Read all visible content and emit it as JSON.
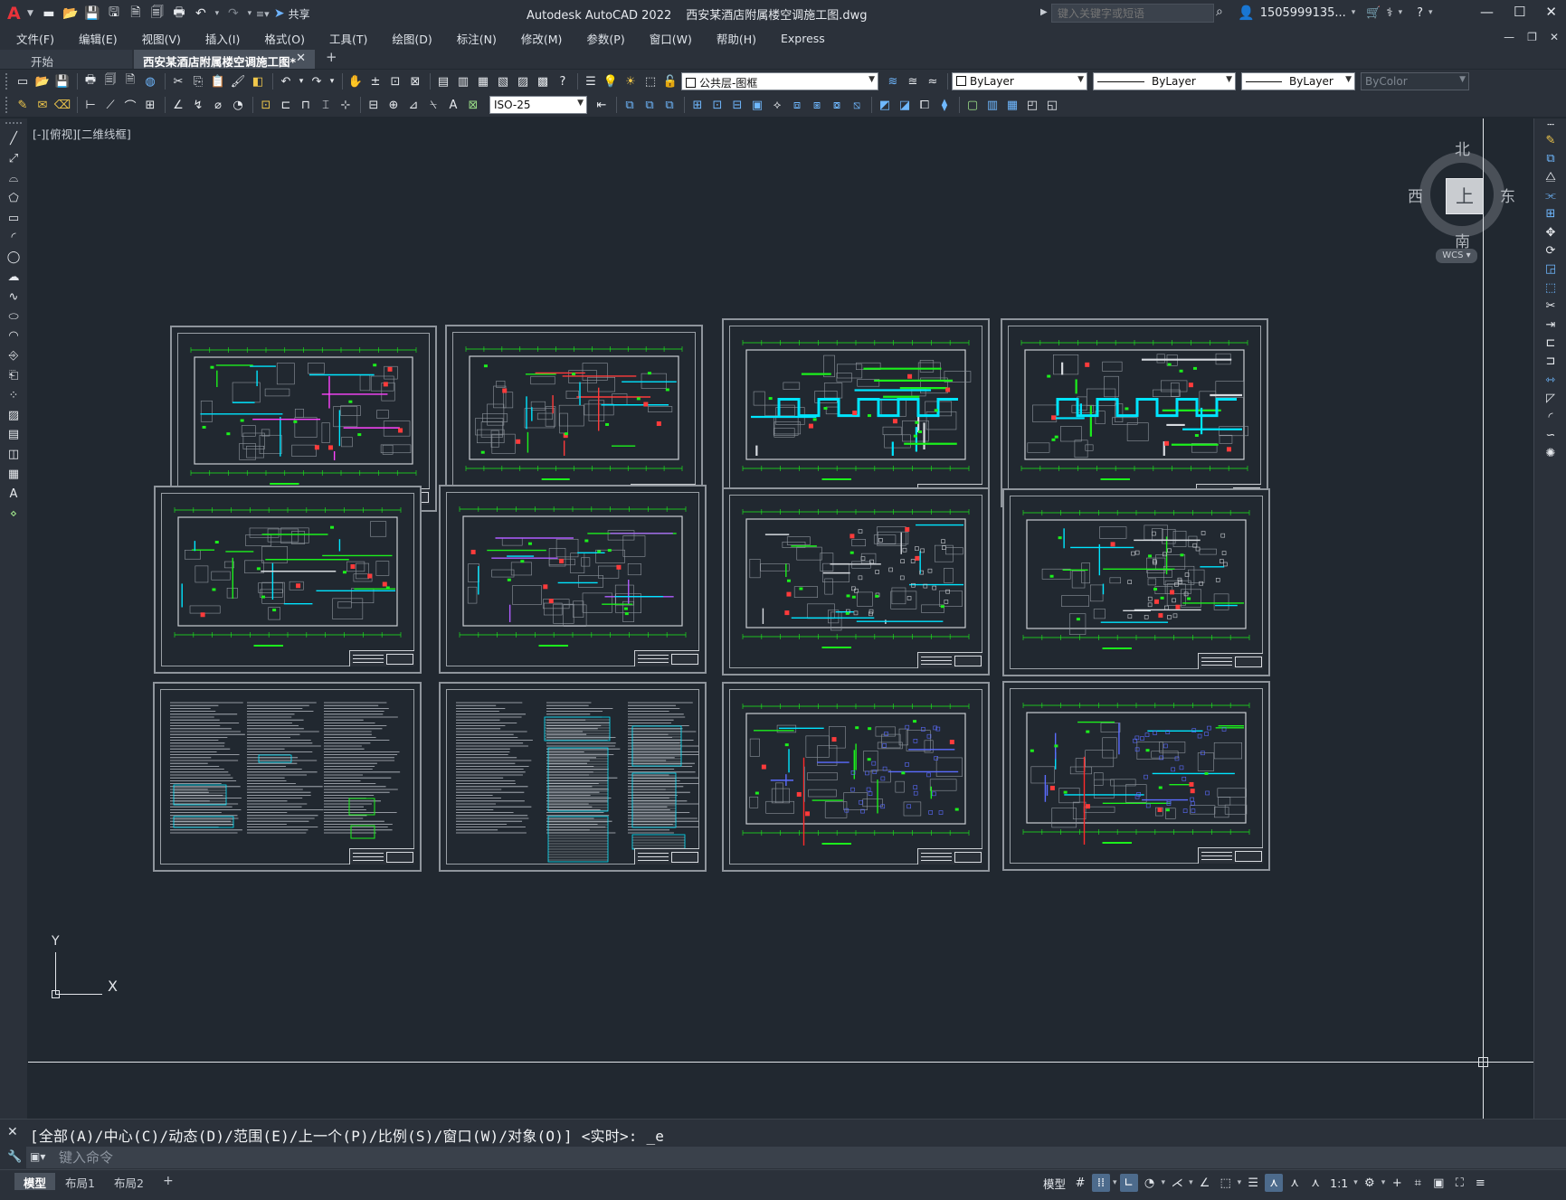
{
  "titlebar": {
    "app_title": "Autodesk AutoCAD 2022",
    "file_title": "西安某酒店附属楼空调施工图.dwg",
    "share_label": "共享",
    "search_placeholder": "键入关键字或短语",
    "user": "1505999135...",
    "icons": [
      "new-icon",
      "open-icon",
      "save-icon",
      "saveas-icon",
      "publish-icon",
      "plot-icon",
      "undo-icon",
      "redo-icon"
    ]
  },
  "menu": [
    "文件(F)",
    "编辑(E)",
    "视图(V)",
    "插入(I)",
    "格式(O)",
    "工具(T)",
    "绘图(D)",
    "标注(N)",
    "修改(M)",
    "参数(P)",
    "窗口(W)",
    "帮助(H)",
    "Express"
  ],
  "tabs": {
    "start": "开始",
    "document": "西安某酒店附属楼空调施工图*",
    "add": "+"
  },
  "toolbar": {
    "layer_name": "公共层-图框",
    "color": "ByLayer",
    "linetype": "ByLayer",
    "lineweight": "ByLayer",
    "plotstyle": "ByColor",
    "dimstyle": "ISO-25"
  },
  "canvas": {
    "viewport_label": "[-][俯视][二维线框]",
    "compass": {
      "north": "北",
      "south": "南",
      "east": "东",
      "west": "西",
      "top": "上"
    },
    "wcs_label": "WCS",
    "ucs": {
      "x": "X",
      "y": "Y"
    }
  },
  "sheets": [
    {
      "id": 1,
      "kind": "plan-colorful"
    },
    {
      "id": 2,
      "kind": "plan-cyan"
    },
    {
      "id": 3,
      "kind": "plan-duct"
    },
    {
      "id": 4,
      "kind": "plan-duct"
    },
    {
      "id": 5,
      "kind": "plan-sparse"
    },
    {
      "id": 6,
      "kind": "plan-magenta"
    },
    {
      "id": 7,
      "kind": "plan-furnished"
    },
    {
      "id": 8,
      "kind": "plan-furnished"
    },
    {
      "id": 9,
      "kind": "notes"
    },
    {
      "id": 10,
      "kind": "tables"
    },
    {
      "id": 11,
      "kind": "plan-restaurant"
    },
    {
      "id": 12,
      "kind": "plan-restaurant"
    }
  ],
  "command": {
    "history": "[全部(A)/中心(C)/动态(D)/范围(E)/上一个(P)/比例(S)/窗口(W)/对象(O)] <实时>: _e",
    "input_placeholder": "键入命令"
  },
  "status": {
    "layout_tabs": [
      "模型",
      "布局1",
      "布局2"
    ],
    "model_label": "模型",
    "scale": "1:1"
  }
}
